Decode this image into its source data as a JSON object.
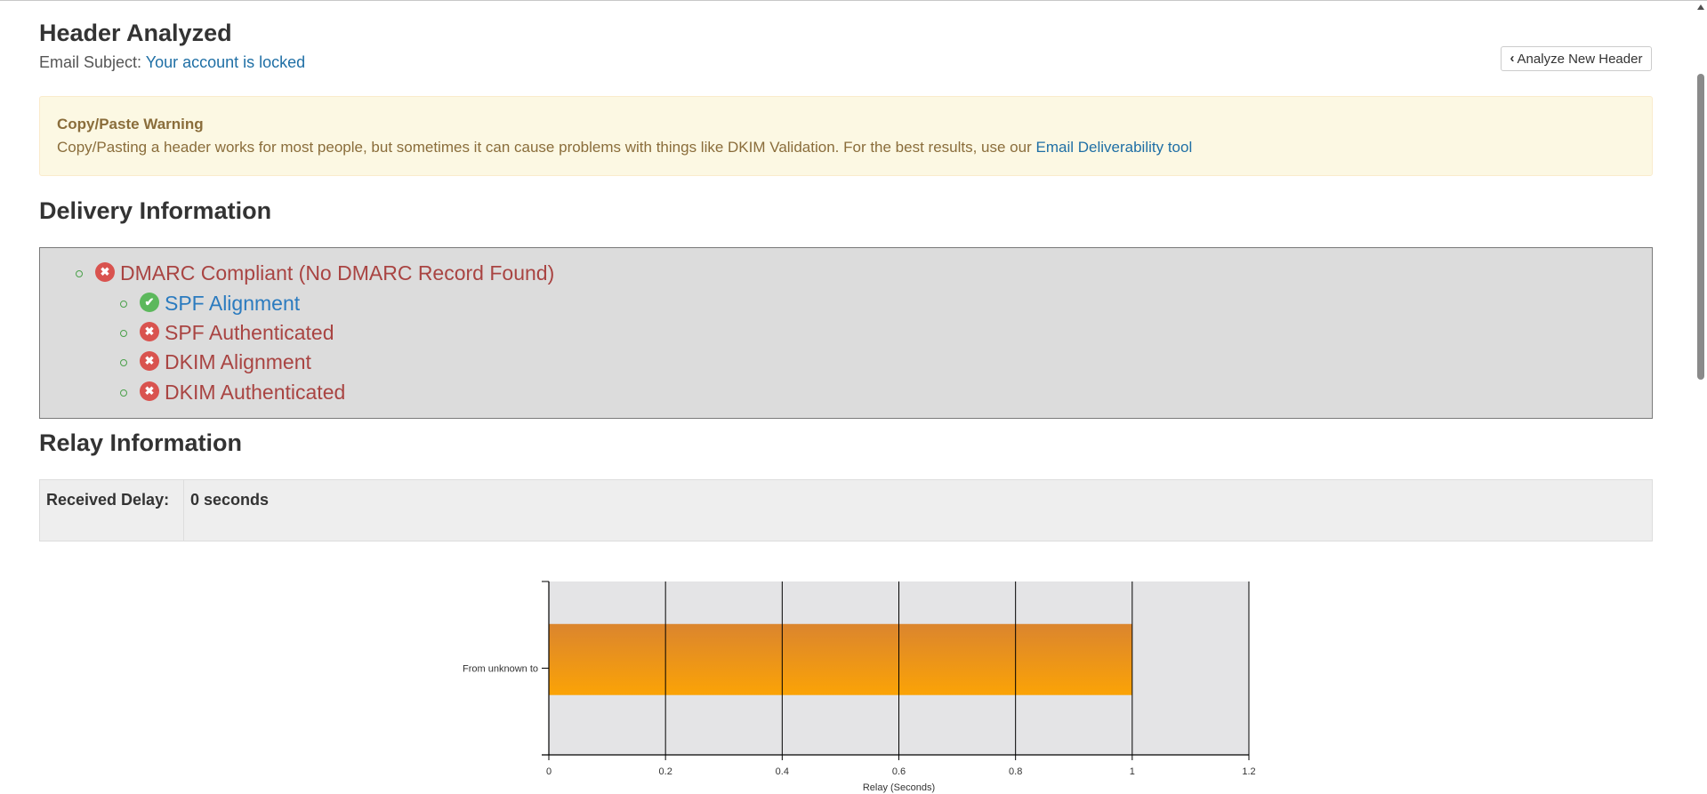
{
  "header": {
    "title": "Header Analyzed",
    "subject_label": "Email Subject:",
    "subject_value": "Your account is locked",
    "analyze_button": "Analyze New Header"
  },
  "warning": {
    "title": "Copy/Paste Warning",
    "text": "Copy/Pasting a header works for most people, but sometimes it can cause problems with things like DKIM Validation. For the best results, use our",
    "link": "Email Deliverability tool"
  },
  "delivery": {
    "title": "Delivery Information",
    "items": [
      {
        "label": "DMARC Compliant (No DMARC Record Found)",
        "status": "fail",
        "level": 0
      },
      {
        "label": "SPF Alignment",
        "status": "pass",
        "level": 1
      },
      {
        "label": "SPF Authenticated",
        "status": "fail",
        "level": 1
      },
      {
        "label": "DKIM Alignment",
        "status": "fail",
        "level": 1
      },
      {
        "label": "DKIM Authenticated",
        "status": "fail",
        "level": 1
      }
    ]
  },
  "relay": {
    "title": "Relay Information",
    "received_delay_label": "Received Delay:",
    "received_delay_value": "0 seconds"
  },
  "colors": {
    "fail": "#d9534f",
    "pass": "#5cb85c",
    "bar_top": "#db852e",
    "bar_bottom": "#fba306"
  },
  "chart_data": {
    "type": "bar",
    "orientation": "horizontal",
    "categories": [
      "From unknown to"
    ],
    "values": [
      1
    ],
    "xlabel": "Relay (Seconds)",
    "ylabel": "",
    "xlim": [
      0,
      1.2
    ],
    "xticks": [
      "0",
      "0.2",
      "0.4",
      "0.6",
      "0.8",
      "1",
      "1.2"
    ],
    "grid": true
  }
}
